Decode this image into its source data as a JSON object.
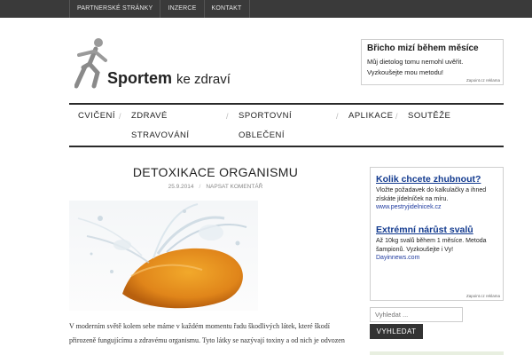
{
  "top_nav": [
    "PARTNERSKÉ STRÁNKY",
    "INZERCE",
    "KONTAKT"
  ],
  "logo": {
    "bold": "Sportem",
    "light": "ke zdraví"
  },
  "top_ad": {
    "title": "Břicho mizí během měsíce",
    "line1": "Můj dietolog tomu nemohl uvěřit.",
    "line2": "Vyzkoušejte mou metodu!",
    "source": "Zapoint.cz reklama"
  },
  "main_nav": {
    "cviceni": "CVIČENÍ",
    "zdrave_1": "ZDRAVÉ",
    "zdrave_2": "STRAVOVÁNÍ",
    "sportovni_1": "SPORTOVNÍ",
    "sportovni_2": "OBLEČENÍ",
    "aplikace": "APLIKACE",
    "souteze": "SOUTĚŽE"
  },
  "article": {
    "title": "DETOXIKACE ORGANISMU",
    "date": "25.9.2014",
    "comment_link": "NAPSAT KOMENTÁŘ",
    "line1": "V moderním světě kolem sebe máme v každém momentu řadu škodlivých látek, které škodí",
    "line2": "přirozeně fungujícímu a zdravému organismu. Tyto látky se nazývají toxiny a od nich je odvozen"
  },
  "side_ad": {
    "ad1_title": "Kolik chcete zhubnout?",
    "ad1_line1": "Vložte požadavek do kalkulačky a ihned",
    "ad1_line2": "získáte jídelníček na míru.",
    "ad1_url": "www.pestryjidelnicek.cz",
    "ad2_title": "Extrémní nárůst svalů",
    "ad2_line1": "Až 10kg svalů během 1 měsíce. Metoda",
    "ad2_line2": "šampionů. Vyzkoušejte i Vy!",
    "ad2_url": "Dayinnews.com",
    "source": "Zapoint.cz reklama"
  },
  "search": {
    "placeholder": "Vyhledat ...",
    "button": "VYHLEDAT"
  },
  "colors": {
    "top_bar": "#3a3a3a",
    "link_blue": "#123a8f",
    "button": "#333333"
  }
}
